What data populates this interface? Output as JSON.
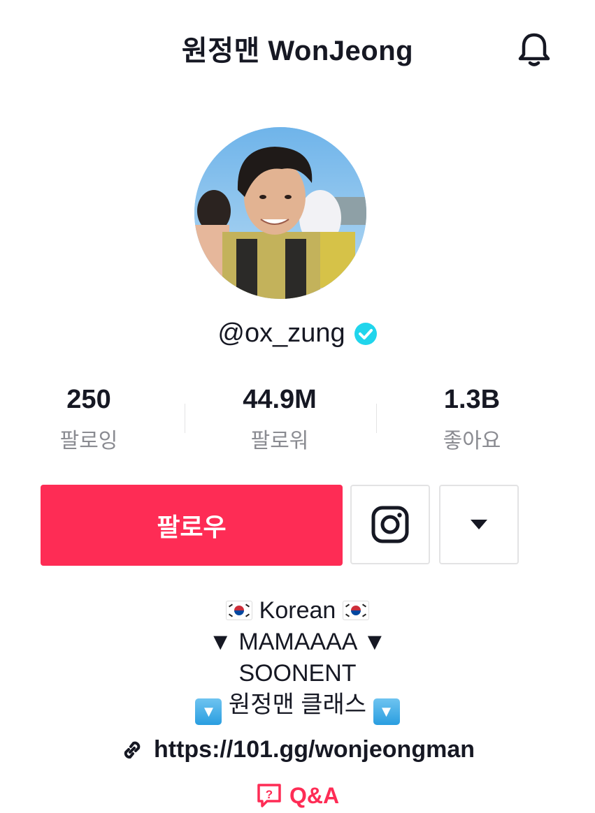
{
  "header": {
    "title": "원정맨 WonJeong",
    "bell_icon": "bell-icon"
  },
  "profile": {
    "username": "@ox_zung",
    "verified_icon": "verified-badge-icon"
  },
  "stats": [
    {
      "value": "250",
      "label": "팔로잉"
    },
    {
      "value": "44.9M",
      "label": "팔로워"
    },
    {
      "value": "1.3B",
      "label": "좋아요"
    }
  ],
  "actions": {
    "follow_label": "팔로우",
    "instagram_icon": "instagram-icon",
    "dropdown_icon": "triangle-down-icon",
    "follow_color": "#fe2c55"
  },
  "bio": {
    "line1": "Korean",
    "line2": "▼ MAMAAAA ▼",
    "line3": "SOONENT",
    "line4": "원정맨 클래스"
  },
  "link": {
    "url": "https://101.gg/wonjeongman",
    "icon": "link-icon"
  },
  "qa": {
    "label": "Q&A",
    "icon": "question-box-icon"
  }
}
